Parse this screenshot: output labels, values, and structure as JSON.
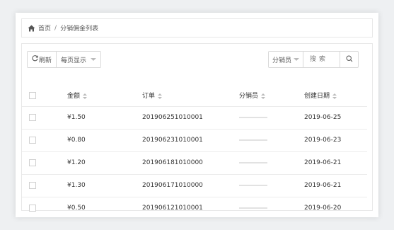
{
  "breadcrumb": {
    "home_label": "首页",
    "separator": "/",
    "current": "分销佣金列表"
  },
  "toolbar": {
    "refresh_label": "刷新",
    "page_size_label": "每页显示",
    "filter_label": "分销员",
    "search_placeholder": "搜索"
  },
  "table": {
    "columns": [
      "金额",
      "订单",
      "分销员",
      "创建日期"
    ],
    "rows": [
      {
        "amount": "¥1.50",
        "order": "201906251010001",
        "seller": "",
        "date": "2019-06-25"
      },
      {
        "amount": "¥0.80",
        "order": "201906231010001",
        "seller": "",
        "date": "2019-06-23"
      },
      {
        "amount": "¥1.20",
        "order": "201906181010000",
        "seller": "",
        "date": "2019-06-21"
      },
      {
        "amount": "¥1.30",
        "order": "201906171010000",
        "seller": "",
        "date": "2019-06-21"
      },
      {
        "amount": "¥0.50",
        "order": "201906121010001",
        "seller": "",
        "date": "2019-06-20"
      }
    ]
  }
}
